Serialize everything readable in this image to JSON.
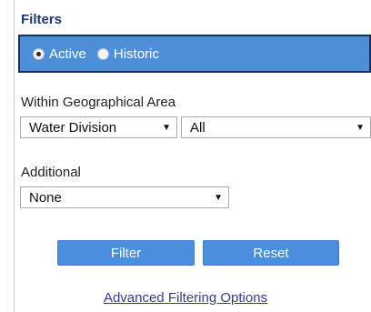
{
  "panel": {
    "title": "Filters",
    "status": {
      "options": [
        {
          "label": "Active",
          "selected": true
        },
        {
          "label": "Historic",
          "selected": false
        }
      ]
    }
  },
  "geo": {
    "label": "Within Geographical Area",
    "area_type": "Water Division",
    "area_value": "All"
  },
  "additional": {
    "label": "Additional",
    "value": "None"
  },
  "buttons": {
    "filter": "Filter",
    "reset": "Reset"
  },
  "advanced_link": "Advanced Filtering Options",
  "colors": {
    "header_bar": "#4f8fd9",
    "button": "#4a8fdc",
    "title": "#1f3a6b"
  }
}
